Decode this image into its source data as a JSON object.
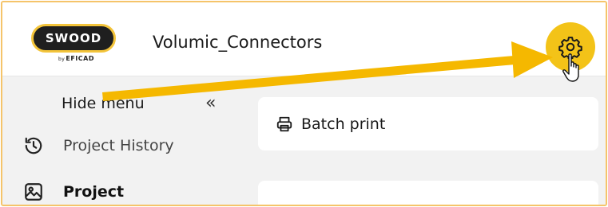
{
  "header": {
    "logo_text": "SWOOD",
    "logo_by": "by",
    "logo_brand": "EFICAD",
    "project_title": "Volumic_Connectors",
    "settings_icon": "gear-icon"
  },
  "sidebar": {
    "hide_menu_label": "Hide menu",
    "collapse_icon": "«",
    "items": [
      {
        "label": "Project History",
        "icon": "history-icon"
      },
      {
        "label": "Project",
        "icon": "image-icon",
        "active": true
      }
    ]
  },
  "main": {
    "batch_print_label": "Batch print",
    "batch_print_icon": "printer-icon"
  },
  "colors": {
    "accent": "#f3c318",
    "arrow": "#f5b800",
    "frame_border": "#f5c46a",
    "logo_dark": "#1f1f1f"
  }
}
